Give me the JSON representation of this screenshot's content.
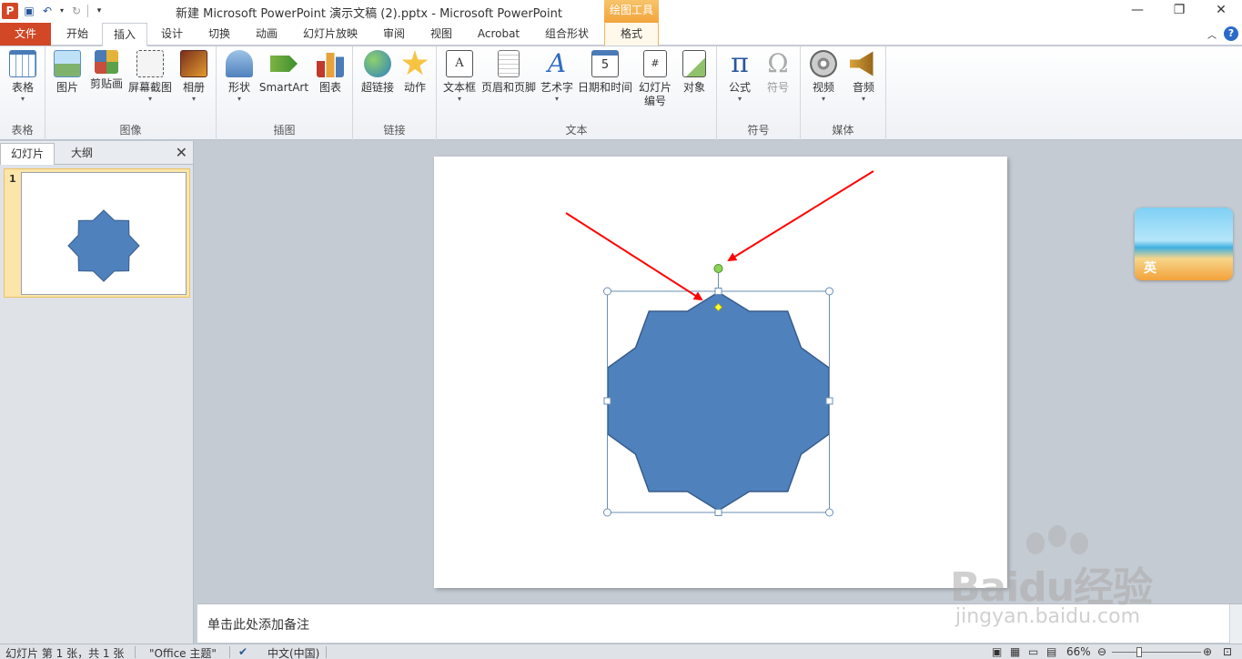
{
  "window": {
    "title": "新建 Microsoft PowerPoint 演示文稿 (2).pptx  -  Microsoft PowerPoint",
    "app_icon": "P",
    "contextual_tab_group": "绘图工具",
    "colors": {
      "file_tab": "#d24726",
      "contextual": "#f3a43b",
      "shape_fill": "#4f81bd",
      "shape_stroke": "#385d8a",
      "arrow": "#ff0000"
    }
  },
  "tabs": [
    "文件",
    "开始",
    "插入",
    "设计",
    "切换",
    "动画",
    "幻灯片放映",
    "审阅",
    "视图",
    "Acrobat",
    "组合形状",
    "格式"
  ],
  "ribbon": {
    "groups": {
      "tables": "表格",
      "images": "图像",
      "illustrations": "插图",
      "links": "链接",
      "text": "文本",
      "symbols": "符号",
      "media": "媒体"
    },
    "buttons": {
      "table": "表格",
      "picture": "图片",
      "clipart": "剪贴画",
      "screenshot": "屏幕截图",
      "album": "相册",
      "shapes": "形状",
      "smartart": "SmartArt",
      "chart": "图表",
      "hyperlink": "超链接",
      "action": "动作",
      "textbox": "文本框",
      "header_footer": "页眉和页脚",
      "wordart": "艺术字",
      "datetime": "日期和时间",
      "slide_number_1": "幻灯片",
      "slide_number_2": "编号",
      "object": "对象",
      "equation": "公式",
      "symbol": "符号",
      "video": "视频",
      "audio": "音频"
    },
    "icons": {
      "table": "table-icon",
      "picture": "picture-icon",
      "clipart": "clipart-icon",
      "screenshot": "screenshot-icon",
      "album": "album-icon",
      "shapes": "shapes-icon",
      "smartart": "smartart-icon",
      "chart": "chart-icon",
      "hyperlink": "globe-link-icon",
      "action": "star-action-icon",
      "textbox": "textbox-icon",
      "header_footer": "header-footer-icon",
      "wordart": "wordart-icon",
      "datetime": "calendar-icon",
      "slide_number": "slide-number-icon",
      "object": "object-icon",
      "equation": "pi-icon",
      "symbol": "omega-icon",
      "video": "film-reel-icon",
      "audio": "speaker-icon"
    }
  },
  "panel": {
    "tab_slides": "幻灯片",
    "tab_outline": "大纲",
    "close": "✕",
    "slide_number": "1"
  },
  "ime": {
    "label": "英"
  },
  "notes": {
    "placeholder": "单击此处添加备注"
  },
  "status": {
    "slide_info": "幻灯片 第 1 张，共 1 张",
    "theme": "\"Office 主题\"",
    "language": "中文(中国)",
    "zoom": "66%",
    "zoom_level": 0.66
  },
  "watermark": {
    "main": "Baidu经验",
    "sub": "jingyan.baidu.com"
  }
}
